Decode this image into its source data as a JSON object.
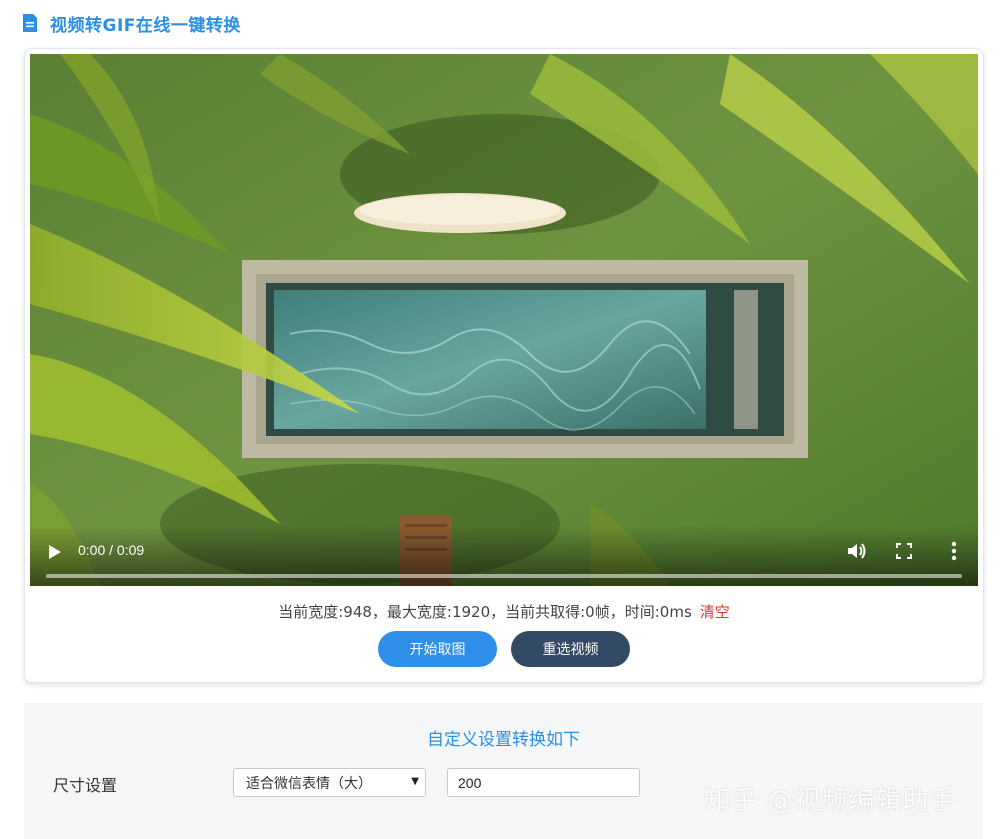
{
  "header": {
    "icon": "document-icon",
    "title": "视频转GIF在线一键转换",
    "accent_color": "#2b8fe6"
  },
  "video": {
    "time_display": "0:00 / 0:09",
    "progress": 0,
    "controls": [
      "play-icon",
      "volume-icon",
      "fullscreen-icon",
      "more-vertical-icon"
    ]
  },
  "info": {
    "text": "当前宽度:948，最大宽度:1920，当前共取得:0帧，时间:0ms",
    "clear_label": "清空",
    "clear_color": "#e2362b"
  },
  "buttons": {
    "start_label": "开始取图",
    "start_color": "#2e8fe8",
    "reselect_label": "重选视频",
    "reselect_color": "#334a64"
  },
  "settings": {
    "title": "自定义设置转换如下",
    "size_label": "尺寸设置",
    "size_select_value": "适合微信表情（大）",
    "size_input_value": "200"
  },
  "watermark": "知乎 @视频编辑助手"
}
